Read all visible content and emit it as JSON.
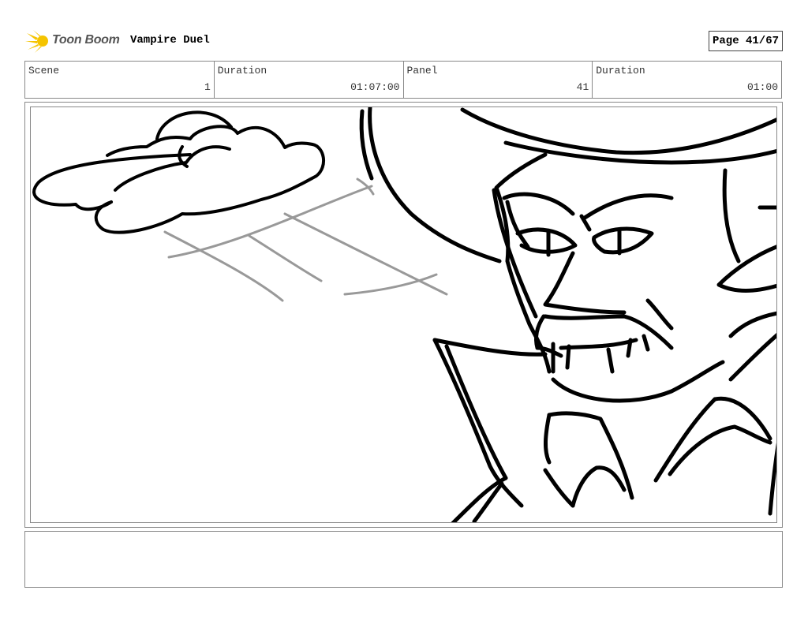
{
  "header": {
    "logo_text": "Toon Boom",
    "logo_icon": "sun-comet-icon",
    "title": "Vampire Duel",
    "page": "Page 41/67"
  },
  "info": {
    "scene_label": "Scene",
    "scene_value": "1",
    "scene_duration_label": "Duration",
    "scene_duration_value": "01:07:00",
    "panel_label": "Panel",
    "panel_value": "41",
    "panel_duration_label": "Duration",
    "panel_duration_value": "01:00"
  },
  "notes": {
    "text": ""
  },
  "colors": {
    "logo_yellow": "#f5c400",
    "ink": "#000000",
    "motion_lines": "#999999"
  }
}
